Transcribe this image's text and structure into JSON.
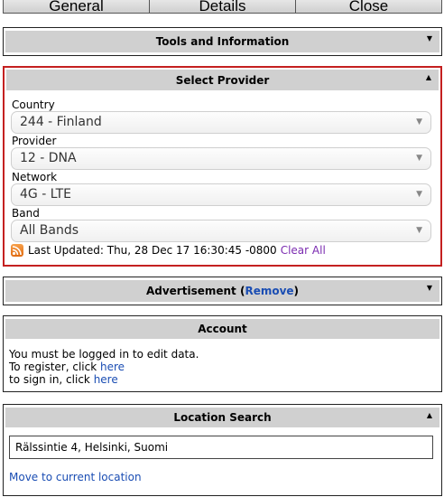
{
  "tabs": [
    "General",
    "Details",
    "Close"
  ],
  "tools_panel": {
    "title": "Tools and Information"
  },
  "provider_panel": {
    "title": "Select Provider",
    "country_label": "Country",
    "country_value": "244 - Finland",
    "provider_label": "Provider",
    "provider_value": "12 - DNA",
    "network_label": "Network",
    "network_value": "4G - LTE",
    "band_label": "Band",
    "band_value": "All Bands",
    "last_updated": "Last Updated: Thu, 28 Dec 17 16:30:45 -0800",
    "clear_all": "Clear All"
  },
  "ad_panel": {
    "title": "Advertisement (",
    "remove": "Remove",
    "close_paren": ")"
  },
  "account_panel": {
    "title": "Account",
    "line1": "You must be logged in to edit data.",
    "line2_prefix": "To register, click ",
    "line3_prefix": "to sign in, click ",
    "here": "here"
  },
  "location_panel": {
    "title": "Location Search",
    "search_value": "Rälssintie 4, Helsinki, Suomi",
    "move_link": "Move to current location"
  },
  "icons": {
    "collapse": "chevron-down-icon",
    "expand": "chevron-up-icon",
    "rss": "rss-icon"
  },
  "colors": {
    "accent_border": "#c42020",
    "link": "#1a4db3",
    "visited_link": "#7b2bb0",
    "header_bg": "#d0d0d0"
  }
}
